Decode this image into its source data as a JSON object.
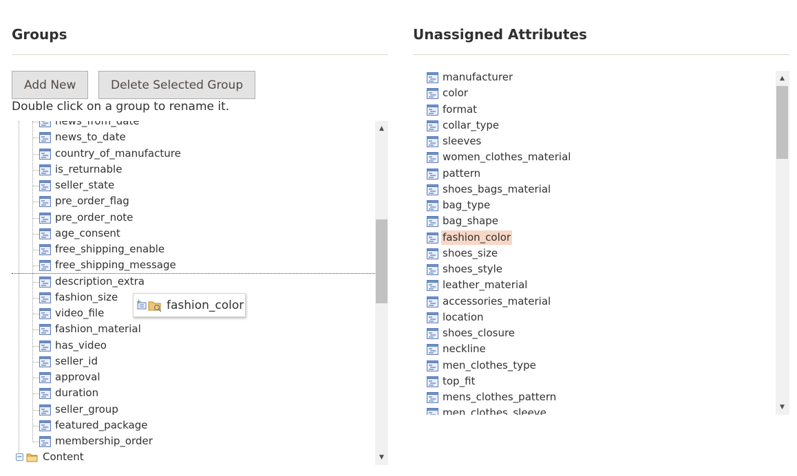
{
  "groups": {
    "title": "Groups",
    "add_new_label": "Add New",
    "delete_label": "Delete Selected Group",
    "hint": "Double click on a group to rename it.",
    "items": [
      "news_from_date",
      "news_to_date",
      "country_of_manufacture",
      "is_returnable",
      "seller_state",
      "pre_order_flag",
      "pre_order_note",
      "age_consent",
      "free_shipping_enable",
      "free_shipping_message",
      "description_extra",
      "fashion_size",
      "video_file",
      "fashion_material",
      "has_video",
      "seller_id",
      "approval",
      "duration",
      "seller_group",
      "featured_package",
      "membership_order"
    ],
    "folder_label": "Content"
  },
  "drag_proxy": {
    "label": "fashion_color"
  },
  "unassigned": {
    "title": "Unassigned Attributes",
    "selected": "fashion_color",
    "items": [
      "manufacturer",
      "color",
      "format",
      "collar_type",
      "sleeves",
      "women_clothes_material",
      "pattern",
      "shoes_bags_material",
      "bag_type",
      "bag_shape",
      "fashion_color",
      "shoes_size",
      "shoes_style",
      "leather_material",
      "accessories_material",
      "location",
      "shoes_closure",
      "neckline",
      "men_clothes_type",
      "top_fit",
      "mens_clothes_pattern",
      "men_clothes_sleeve"
    ]
  },
  "colors": {
    "selected_bg": "#f8d7c7",
    "rule": "#d6d6c4",
    "button_bg": "#e3e3e3"
  }
}
